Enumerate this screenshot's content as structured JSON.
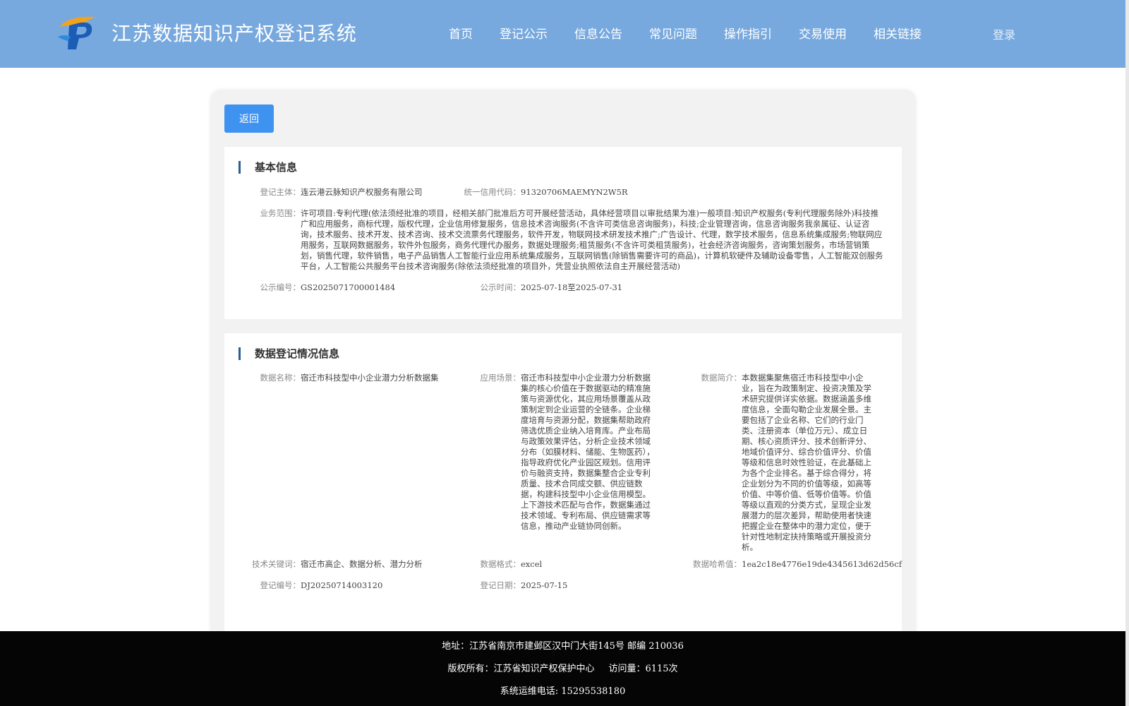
{
  "header": {
    "site_title": "江苏数据知识产权登记系统",
    "nav": [
      "首页",
      "登记公示",
      "信息公告",
      "常见问题",
      "操作指引",
      "交易使用",
      "相关链接"
    ],
    "login": "登录"
  },
  "back_label": "返回",
  "basic_info": {
    "title": "基本信息",
    "entity_label": "登记主体：",
    "entity_value": "连云港云脉知识产权服务有限公司",
    "credit_label": "统一信用代码：",
    "credit_value": "91320706MAEMYN2W5R",
    "scope_label": "业务范围：",
    "scope_value": "许可项目:专利代理(依法须经批准的项目，经相关部门批准后方可开展经营活动，具体经营项目以审批结果为准)一般项目:知识产权服务(专利代理服务除外)科技推广和应用服务，商标代理，版权代理，企业信用修复服务，信息技术咨询服务(不含许可类信息咨询服务)，科技;企业管理咨询，信息咨询服务我亲属征、认证咨询，技术服务、技术开发、技术咨询、技术交流票务代理服务，软件开发，物联网技术研发技术推广;广告设计、代理，数学技术服务，信息系统集成服务;物联网应用服务，互联网数据服务，软件外包服务，商务代理代办服务，数据处理服务;租赁服务(不含许可类租赁服务)，社会经济咨询服务，咨询策划服务，市场营销策划，销售代理，软件销售，电子产品销售人工智能行业应用系统集成服务，互联网销售(除销售需要许可的商品)，计算机软硬件及辅助设备零售，人工智能双创服务平台，人工智能公共服务平台技术咨询服务(除依法须经批准的项目外，凭营业执照依法自主开展经营活动)",
    "notice_no_label": "公示编号：",
    "notice_no_value": "GS2025071700001484",
    "notice_time_label": "公示时间：",
    "notice_time_value": "2025-07-18至2025-07-31"
  },
  "registration_info": {
    "title": "数据登记情况信息",
    "name_label": "数据名称：",
    "name_value": "宿迁市科技型中小企业潜力分析数据集",
    "scene_label": "应用场景：",
    "scene_value": "宿迁市科技型中小企业潜力分析数据集的核心价值在于数据驱动的精准施策与资源优化，其应用场景覆盖从政策制定到企业运营的全链条。企业梯度培育与资源分配，数据集帮助政府筛选优质企业纳入培育库。产业布局与政策效果评估，分析企业技术领域分布（如膜材料、储能、生物医药），指导政府优化产业园区规划。信用评价与融资支持，数据集整合企业专利质量、技术合同成交额、供应链数据，构建科技型中小企业信用模型。上下游技术匹配与合作，数据集通过技术领域、专利布局、供应链需求等信息，推动产业链协同创新。",
    "intro_label": "数据简介：",
    "intro_value": "本数据集聚焦宿迁市科技型中小企业，旨在为政策制定、投资决策及学术研究提供详实依据。数据涵盖多维度信息，全面勾勒企业发展全景。主要包括了企业名称、它们的行业门类、注册资本（单位万元）、成立日期、核心资质评分、技术创新评分、地域价值评分、综合价值评分、价值等级和信息时效性验证，在此基础上为各个企业排名。基于综合得分，将企业划分为不同的价值等级，如高等价值、中等价值、低等价值等。价值等级以直观的分类方式，呈现企业发展潜力的层次差异，帮助使用者快速把握企业在整体中的潜力定位，便于针对性地制定扶持策略或开展投资分析。",
    "keywords_label": "技术关键词：",
    "keywords_value": "宿迁市高企、数据分析、潜力分析",
    "format_label": "数据格式：",
    "format_value": "excel",
    "hash_label": "数据哈希值：",
    "hash_value": "1ea2c18e4776e19de4345613d62d56cf",
    "reg_no_label": "登记编号：",
    "reg_no_value": "DJ20250714003120",
    "reg_date_label": "登记日期：",
    "reg_date_value": "2025-07-15"
  },
  "footer": {
    "address": "地址：江苏省南京市建邺区汉中门大街145号 邮编 210036",
    "copyright": "版权所有：江苏省知识产权保护中心",
    "visits": "访问量：6115次",
    "phone": "系统运维电话: 15295538180"
  },
  "colors": {
    "header_bg": "#77a9df",
    "button_bg": "#3f93f0",
    "title_bar": "#2b5c98",
    "footer_bg": "#050505"
  }
}
